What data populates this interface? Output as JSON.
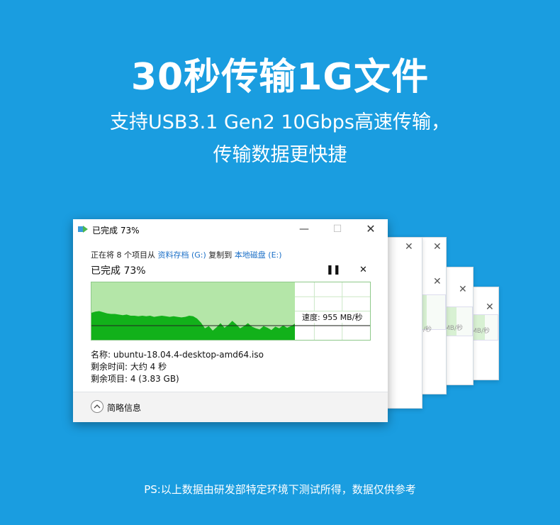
{
  "header": {
    "title": "30秒传输1G文件",
    "subtitle_line1": "支持USB3.1 Gen2 10Gbps高速传输，",
    "subtitle_line2": "传输数据更快捷"
  },
  "dialog": {
    "title": "已完成 73%",
    "copy_prefix": "正在将 8 个项目从 ",
    "source": "资料存档 (G:)",
    "copy_middle": " 复制到 ",
    "destination": "本地磁盘 (E:)",
    "percent_label": "已完成 73%",
    "progress_fraction": 0.73,
    "speed_label": "速度: 955 MB/秒",
    "name_label": "名称: ubuntu-18.04.4-desktop-amd64.iso",
    "time_remaining": "剩余时间: 大约 4 秒",
    "items_remaining": "剩余项目: 4 (3.83 GB)",
    "fewer_details": "简略信息",
    "pause_icon": "pause-icon",
    "close_icon": "close-icon"
  },
  "ghost_speed_label": "MB/秒",
  "footnote": "PS:以上数据由研发部特定环境下测试所得，数据仅供参考",
  "colors": {
    "background": "#1a9de0",
    "graph_fill": "#12b11a",
    "graph_area": "#b4e6a8",
    "link": "#1a6fc7"
  }
}
